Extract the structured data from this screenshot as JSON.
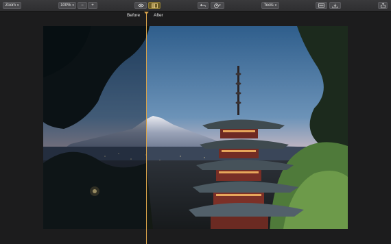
{
  "toolbar": {
    "zoom_label": "Zoom",
    "zoom_level": "100%",
    "zoom_out": "−",
    "zoom_in": "+",
    "tools_label": "Tools"
  },
  "compare": {
    "before_label": "Before",
    "after_label": "After",
    "split_position": 0.34
  },
  "icons": {
    "eye": "eye-icon",
    "compare": "compare-split-icon",
    "undo": "undo-icon",
    "history": "history-icon",
    "adjust": "adjust-icon",
    "export": "export-icon",
    "share": "share-icon"
  },
  "colors": {
    "accent": "#d8a24a",
    "toolbar": "#333335",
    "canvas": "#1c1c1d"
  }
}
